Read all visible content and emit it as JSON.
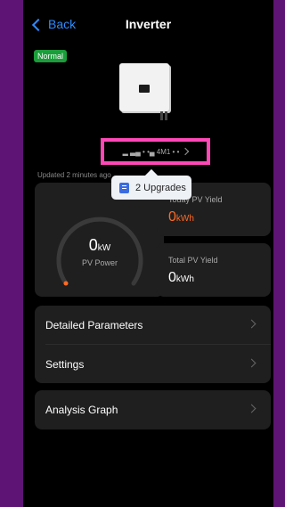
{
  "header": {
    "back_label": "Back",
    "title": "Inverter"
  },
  "status": {
    "badge": "Normal"
  },
  "device": {
    "serial": "▂ ▃▄ • •▄ 4M1 • •"
  },
  "updated_text": "Updated 2 minutes ago",
  "tooltip": {
    "label": "2 Upgrades"
  },
  "pv_power": {
    "value": "0",
    "unit": "kW",
    "label": "PV Power",
    "progress": 0
  },
  "today_yield": {
    "label": "Today PV Yield",
    "value": "0",
    "unit": "kWh"
  },
  "total_yield": {
    "label": "Total PV Yield",
    "value": "0",
    "unit": "kWh"
  },
  "menu": {
    "detailed": "Detailed Parameters",
    "settings": "Settings",
    "analysis": "Analysis Graph"
  },
  "colors": {
    "accent": "#2f8cff",
    "status_green": "#1a9d3a",
    "highlight": "#ff48b8",
    "yield_orange": "#ff6a24",
    "frame": "#5e1474"
  }
}
